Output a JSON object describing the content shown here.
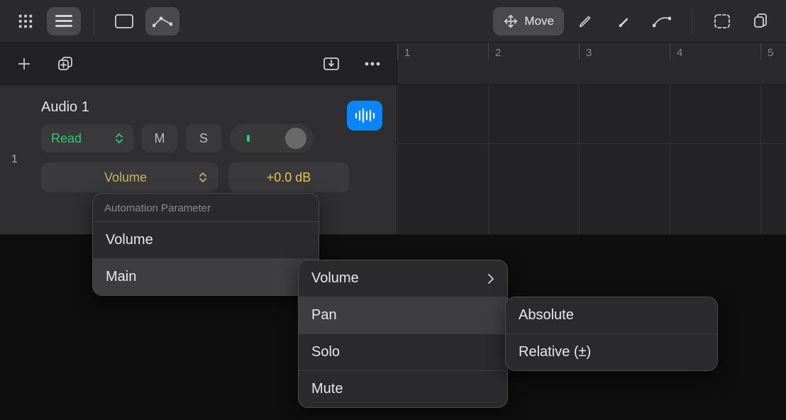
{
  "toolbar": {
    "move_label": "Move"
  },
  "ruler": {
    "ticks": [
      "1",
      "2",
      "3",
      "4",
      "5"
    ]
  },
  "track": {
    "number": "1",
    "name": "Audio 1",
    "automation_mode": "Read",
    "mute_label": "M",
    "solo_label": "S",
    "param_label": "Volume",
    "param_value": "+0.0 dB"
  },
  "popup1": {
    "title": "Automation Parameter",
    "items": [
      "Volume",
      "Main"
    ]
  },
  "popup2": {
    "items": [
      "Volume",
      "Pan",
      "Solo",
      "Mute"
    ]
  },
  "popup3": {
    "items": [
      "Absolute",
      "Relative (±)"
    ]
  }
}
